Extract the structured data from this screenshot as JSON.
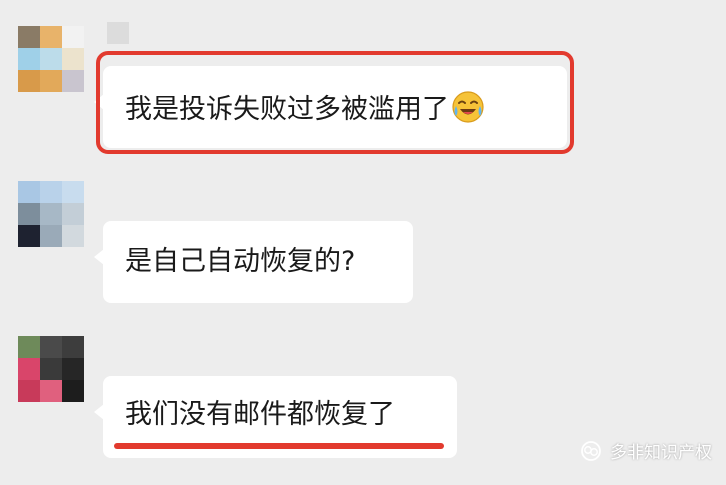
{
  "colors": {
    "background": "#ededed",
    "bubble": "#ffffff",
    "highlight": "#e23a2e",
    "text": "#1a1a1a"
  },
  "messages": [
    {
      "text": "我是投诉失败过多被滥用了",
      "emoji": "face-with-tears-of-joy-icon",
      "highlighted": true
    },
    {
      "text": "是自己自动恢复的?"
    },
    {
      "text": "我们没有邮件都恢复了",
      "underlined": true
    }
  ],
  "watermark": {
    "icon": "wechat-official-account-icon",
    "text": "多非知识产权"
  }
}
